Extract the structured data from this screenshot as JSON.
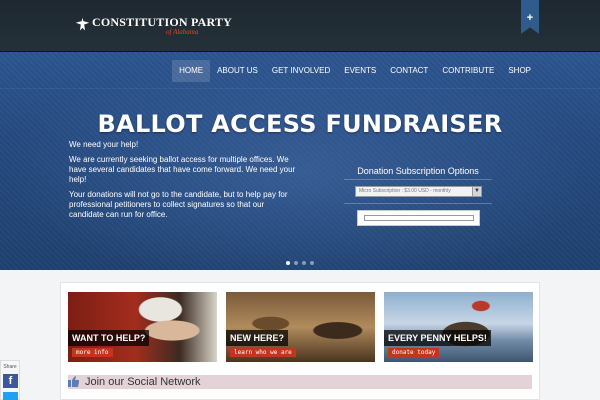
{
  "header": {
    "logo_title": "CONSTITUTION PARTY",
    "logo_subtitle": "of Alabama",
    "toggle_label": "+"
  },
  "nav": {
    "items": [
      "HOME",
      "ABOUT US",
      "GET INVOLVED",
      "EVENTS",
      "CONTACT",
      "CONTRIBUTE",
      "SHOP"
    ],
    "active": "HOME"
  },
  "hero": {
    "title": "BALLOT ACCESS FUNDRAISER",
    "paragraphs": [
      "We need your help!",
      "We are currently seeking ballot access for multiple offices.  We have several candidates that have come forward.  We need your help!",
      "Your donations will not go to the candidate, but to help pay for professional petitioners to collect signatures so that our candidate can run for office."
    ],
    "donation_label": "Donation Subscription Options",
    "donation_selected": "Micro Subscription : $3.00 USD - monthly",
    "slide_count": 4,
    "active_slide": 1
  },
  "features": [
    {
      "title": "WANT TO HELP?",
      "button": "more info"
    },
    {
      "title": "NEW HERE?",
      "button": "learn who we are"
    },
    {
      "title": "EVERY PENNY HELPS!",
      "button": "donate today"
    }
  ],
  "social": {
    "title": "Join our Social Network"
  },
  "share": {
    "label": "Share"
  },
  "colors": {
    "accent": "#c1361d",
    "hero_blue": "#2c5590",
    "topbar": "#1d2830",
    "logo_subtitle": "#e0442b"
  },
  "icons": [
    "eagle-logo-icon",
    "plus-icon",
    "dropdown-arrow-icon",
    "thumbs-up-icon",
    "facebook-icon",
    "twitter-icon"
  ]
}
